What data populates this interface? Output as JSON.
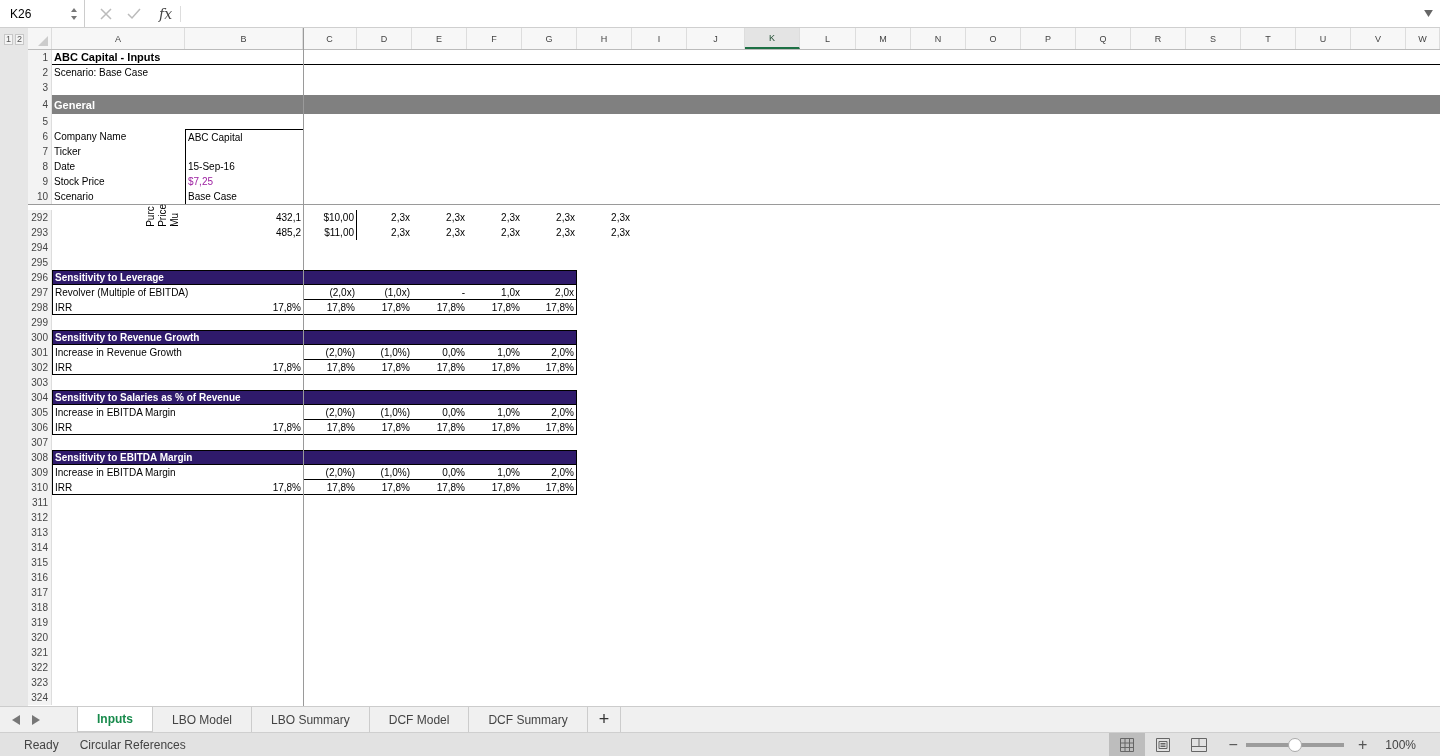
{
  "name_box": "K26",
  "formula_bar": {
    "function_label": "fx"
  },
  "outline_levels": [
    "1",
    "2"
  ],
  "columns": [
    {
      "label": "A",
      "selected": false
    },
    {
      "label": "B",
      "selected": false
    },
    {
      "label": "C",
      "selected": false
    },
    {
      "label": "D",
      "selected": false
    },
    {
      "label": "E",
      "selected": false
    },
    {
      "label": "F",
      "selected": false
    },
    {
      "label": "G",
      "selected": false
    },
    {
      "label": "H",
      "selected": false
    },
    {
      "label": "I",
      "selected": false
    },
    {
      "label": "J",
      "selected": false
    },
    {
      "label": "K",
      "selected": true
    },
    {
      "label": "L",
      "selected": false
    },
    {
      "label": "M",
      "selected": false
    },
    {
      "label": "N",
      "selected": false
    },
    {
      "label": "O",
      "selected": false
    },
    {
      "label": "P",
      "selected": false
    },
    {
      "label": "Q",
      "selected": false
    },
    {
      "label": "R",
      "selected": false
    },
    {
      "label": "S",
      "selected": false
    },
    {
      "label": "T",
      "selected": false
    },
    {
      "label": "U",
      "selected": false
    },
    {
      "label": "V",
      "selected": false
    },
    {
      "label": "W",
      "selected": false
    }
  ],
  "frozen_rows": [
    {
      "number": "1",
      "kind": "title",
      "label": "ABC Capital - Inputs"
    },
    {
      "number": "2",
      "kind": "text",
      "label": "Scenario: Base Case"
    },
    {
      "number": "3",
      "kind": "blank"
    },
    {
      "number": "4",
      "kind": "section",
      "label": "General"
    },
    {
      "number": "5",
      "kind": "blank"
    },
    {
      "number": "6",
      "kind": "field",
      "label": "Company Name",
      "value": "ABC Capital",
      "highlighted": false
    },
    {
      "number": "7",
      "kind": "field",
      "label": "Ticker"
    },
    {
      "number": "8",
      "kind": "field",
      "label": "Date",
      "value": "15-Sep-16",
      "highlighted": false
    },
    {
      "number": "9",
      "kind": "field",
      "label": "Stock Price",
      "value": "$7,25",
      "highlighted": true
    },
    {
      "number": "10",
      "kind": "field",
      "label": "Scenario",
      "value": "Base Case",
      "highlighted": false
    }
  ],
  "rows": [
    {
      "number": "292",
      "kind": "matrix",
      "rotated_labels": [
        "Purc",
        "Price",
        "Mu"
      ],
      "b": "432,1",
      "c": "$10,00",
      "cells": [
        "2,3x",
        "2,3x",
        "2,3x",
        "2,3x",
        "2,3x"
      ]
    },
    {
      "number": "293",
      "kind": "matrix",
      "b": "485,2",
      "c": "$11,00",
      "cells": [
        "2,3x",
        "2,3x",
        "2,3x",
        "2,3x",
        "2,3x"
      ]
    },
    {
      "number": "294",
      "kind": "blank"
    },
    {
      "number": "295",
      "kind": "blank"
    },
    {
      "number": "296",
      "kind": "header",
      "label": "Sensitivity to Leverage"
    },
    {
      "number": "297",
      "kind": "param",
      "label": "Revolver (Multiple of EBITDA)",
      "cells": [
        "(2,0x)",
        "(1,0x)",
        "-",
        "1,0x",
        "2,0x"
      ]
    },
    {
      "number": "298",
      "kind": "result",
      "label": "IRR",
      "b": "17,8%",
      "cells": [
        "17,8%",
        "17,8%",
        "17,8%",
        "17,8%",
        "17,8%"
      ]
    },
    {
      "number": "299",
      "kind": "blank"
    },
    {
      "number": "300",
      "kind": "header",
      "label": "Sensitivity to Revenue Growth"
    },
    {
      "number": "301",
      "kind": "param",
      "label": "Increase in Revenue Growth",
      "cells": [
        "(2,0%)",
        "(1,0%)",
        "0,0%",
        "1,0%",
        "2,0%"
      ]
    },
    {
      "number": "302",
      "kind": "result",
      "label": "IRR",
      "b": "17,8%",
      "cells": [
        "17,8%",
        "17,8%",
        "17,8%",
        "17,8%",
        "17,8%"
      ]
    },
    {
      "number": "303",
      "kind": "blank"
    },
    {
      "number": "304",
      "kind": "header",
      "label": "Sensitivity to Salaries as % of Revenue"
    },
    {
      "number": "305",
      "kind": "param",
      "label": "Increase in EBITDA Margin",
      "cells": [
        "(2,0%)",
        "(1,0%)",
        "0,0%",
        "1,0%",
        "2,0%"
      ]
    },
    {
      "number": "306",
      "kind": "result",
      "label": "IRR",
      "b": "17,8%",
      "cells": [
        "17,8%",
        "17,8%",
        "17,8%",
        "17,8%",
        "17,8%"
      ]
    },
    {
      "number": "307",
      "kind": "blank"
    },
    {
      "number": "308",
      "kind": "header",
      "label": "Sensitivity to EBITDA Margin"
    },
    {
      "number": "309",
      "kind": "param",
      "label": "Increase in EBITDA Margin",
      "cells": [
        "(2,0%)",
        "(1,0%)",
        "0,0%",
        "1,0%",
        "2,0%"
      ]
    },
    {
      "number": "310",
      "kind": "result",
      "label": "IRR",
      "b": "17,8%",
      "cells": [
        "17,8%",
        "17,8%",
        "17,8%",
        "17,8%",
        "17,8%"
      ]
    },
    {
      "number": "311",
      "kind": "blank"
    },
    {
      "number": "312",
      "kind": "blank"
    },
    {
      "number": "313",
      "kind": "blank"
    },
    {
      "number": "314",
      "kind": "blank"
    },
    {
      "number": "315",
      "kind": "blank"
    },
    {
      "number": "316",
      "kind": "blank"
    },
    {
      "number": "317",
      "kind": "blank"
    },
    {
      "number": "318",
      "kind": "blank"
    },
    {
      "number": "319",
      "kind": "blank"
    },
    {
      "number": "320",
      "kind": "blank"
    },
    {
      "number": "321",
      "kind": "blank"
    },
    {
      "number": "322",
      "kind": "blank"
    },
    {
      "number": "323",
      "kind": "blank"
    },
    {
      "number": "324",
      "kind": "blank"
    }
  ],
  "sheet_tabs": [
    {
      "label": "Inputs",
      "selected": true
    },
    {
      "label": "LBO Model",
      "selected": false
    },
    {
      "label": "LBO Summary",
      "selected": false
    },
    {
      "label": "DCF Model",
      "selected": false
    },
    {
      "label": "DCF Summary",
      "selected": false
    }
  ],
  "add_sheet": "+",
  "status_bar": {
    "state": "Ready",
    "message": "Circular References",
    "views": [
      {
        "kind": "normal",
        "selected": true
      },
      {
        "kind": "page-layout",
        "selected": false
      },
      {
        "kind": "page-break",
        "selected": false
      }
    ],
    "zoom_out": "−",
    "zoom": {
      "level": 0.5
    },
    "zoom_in": "+",
    "zoom_label": "100%"
  }
}
